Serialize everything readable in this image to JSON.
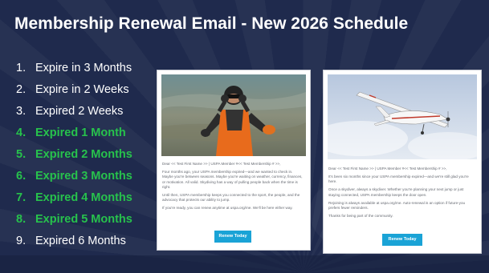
{
  "slide": {
    "title": "Membership Renewal Email -  New 2026 Schedule",
    "background_color": "#1f2a4d"
  },
  "schedule": [
    {
      "number": "1.",
      "label": "Expire in 3 Months",
      "color": "#ffffff"
    },
    {
      "number": "2.",
      "label": "Expire in 2 Weeks",
      "color": "#ffffff"
    },
    {
      "number": "3.",
      "label": "Expired 2 Weeks",
      "color": "#ffffff"
    },
    {
      "number": "4.",
      "label": "Expired 1 Month",
      "color": "#27c24c"
    },
    {
      "number": "5.",
      "label": "Expired 2 Months",
      "color": "#27c24c"
    },
    {
      "number": "6.",
      "label": "Expired 3 Months",
      "color": "#27c24c"
    },
    {
      "number": "7.",
      "label": "Expired 4 Months",
      "color": "#27c24c"
    },
    {
      "number": "8.",
      "label": "Expired 5 Months",
      "color": "#27c24c"
    },
    {
      "number": "9.",
      "label": "Expired 6 Months",
      "color": "#ffffff"
    }
  ],
  "email_left": {
    "image": "skydiver-freefall-photo",
    "greeting": "Dear << Test First Name >> | USPA Member #<< Test Membership # >>,",
    "paragraphs": [
      "Four months ago, your USPA membership expired—and we wanted to check in. Maybe you're between seasons. Maybe you're waiting on weather, currency, finances, or motivation. All valid. Skydiving has a way of pulling people back when the time is right.",
      "Until then, USPA membership keeps you connected to the sport, the people, and the advocacy that protects our ability to jump.",
      "If you're ready, you can renew anytime at uspa.org/me. We'll be here either way."
    ],
    "button_label": "Renew Today",
    "button_color": "#1aa3d6"
  },
  "email_right": {
    "image": "jump-plane-in-sky-photo",
    "greeting": "Dear << Test First Name >> | USPA Member #<< Test Membership # >>,",
    "paragraphs": [
      "It's been six months since your USPA membership expired—and we're still glad you're here.",
      "Once a skydiver, always a skydiver. Whether you're planning your next jump or just staying connected, USPA membership keeps the door open.",
      "Rejoining is always available at uspa.org/me. Auto-renewal is an option if future-you prefers fewer reminders.",
      "Thanks for being part of the community."
    ],
    "button_label": "Renew Today",
    "button_color": "#1aa3d6"
  }
}
